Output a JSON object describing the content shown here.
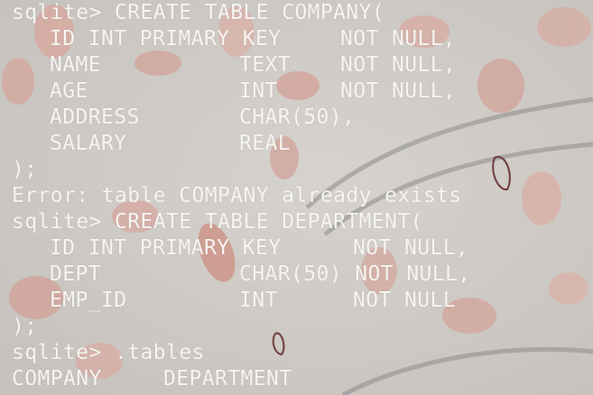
{
  "terminal": {
    "prompt": "sqlite>",
    "lines": [
      {
        "segments": [
          "sqlite> CREATE TABLE COMPANY("
        ]
      },
      {
        "segments": [
          "ID INT PRIMARY KEY",
          "NOT NULL,"
        ]
      },
      {
        "segments": [
          "NAME",
          "TEXT",
          "NOT NULL,"
        ]
      },
      {
        "segments": [
          "AGE",
          "INT",
          "NOT NULL,"
        ]
      },
      {
        "segments": [
          "ADDRESS",
          "CHAR(50),"
        ]
      },
      {
        "segments": [
          "SALARY",
          "REAL"
        ]
      },
      {
        "segments": [
          ");"
        ]
      },
      {
        "segments": [
          "Error: table COMPANY already exists"
        ]
      },
      {
        "segments": [
          "sqlite> CREATE TABLE DEPARTMENT("
        ]
      },
      {
        "segments": [
          "ID INT PRIMARY KEY",
          "NOT NULL,"
        ]
      },
      {
        "segments": [
          "DEPT",
          "CHAR(50) NOT NULL,"
        ]
      },
      {
        "segments": [
          "EMP_ID",
          "INT",
          "NOT NULL"
        ]
      },
      {
        "segments": [
          ");"
        ]
      },
      {
        "segments": [
          "sqlite> .tables"
        ]
      },
      {
        "segments": [
          "COMPANY",
          "DEPARTMENT"
        ]
      }
    ]
  },
  "colors": {
    "text": "#f7f6f3",
    "background": "#cfcbc6",
    "petal": "#d9a79d"
  },
  "icons": [
    "flower-petals-wallpaper"
  ]
}
